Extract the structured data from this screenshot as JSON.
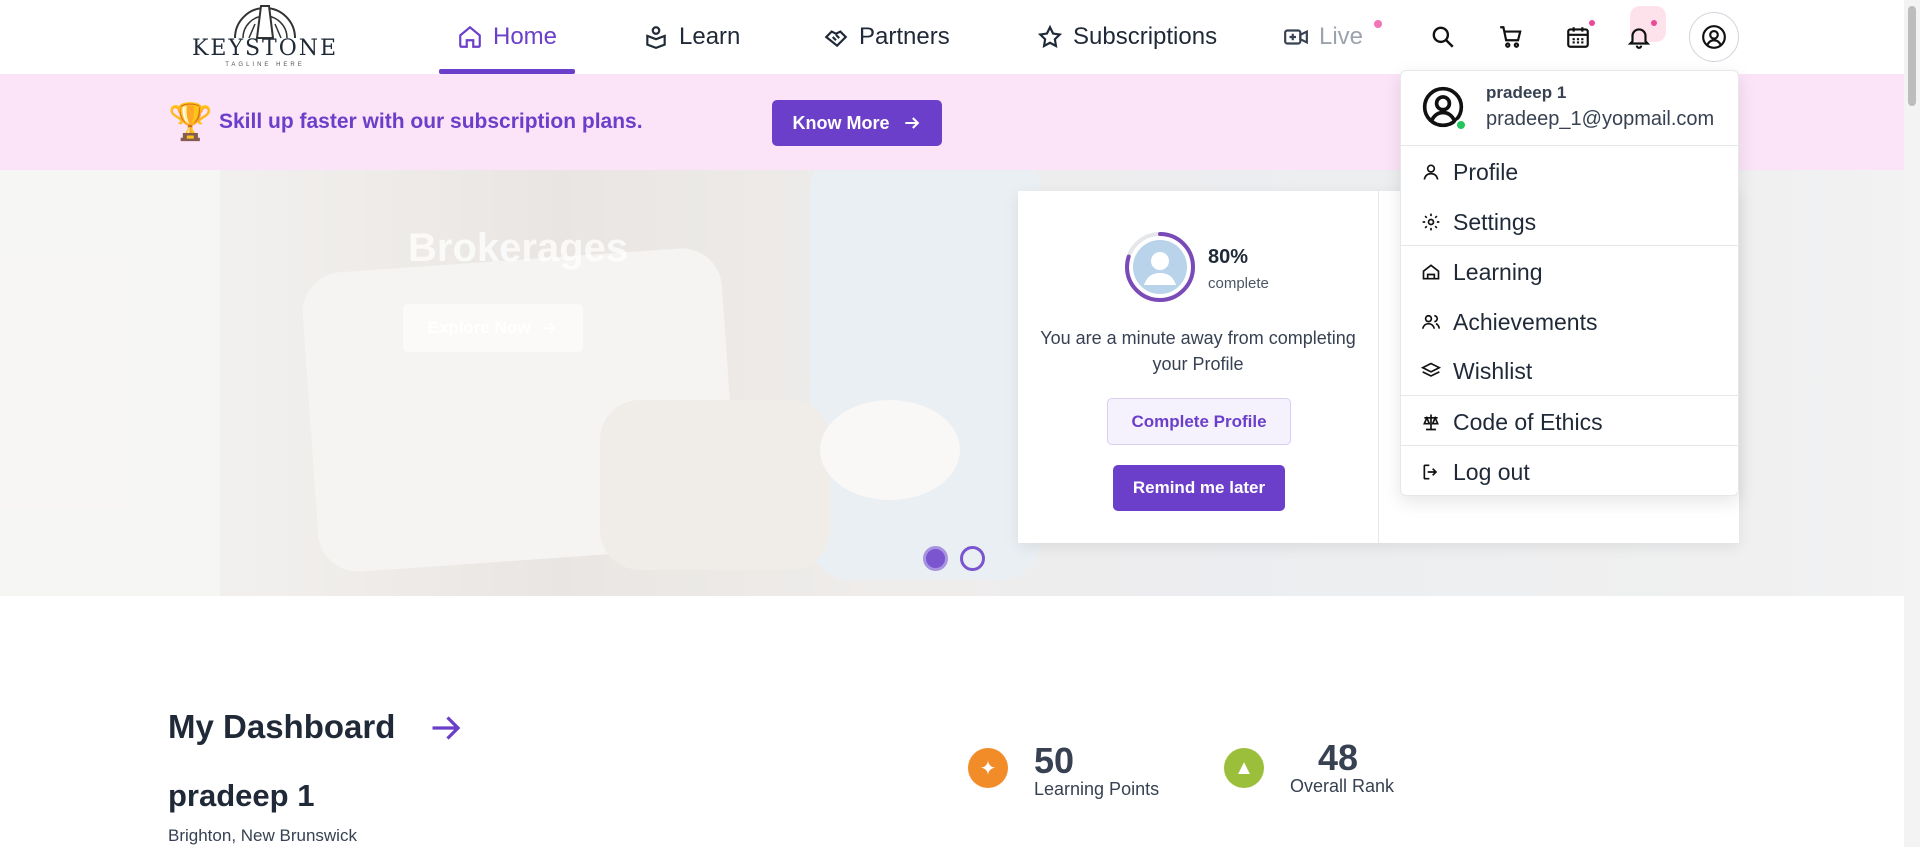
{
  "brand": {
    "name": "KEYSTONE",
    "tagline": "TAGLINE HERE"
  },
  "nav": {
    "home": "Home",
    "learn": "Learn",
    "partners": "Partners",
    "subscriptions": "Subscriptions",
    "live": "Live"
  },
  "promo": {
    "text": "Skill up faster with our subscription plans.",
    "button": "Know More"
  },
  "hero": {
    "title": "Brokerages",
    "button": "Explore Now",
    "slides": 2,
    "active_slide": 1
  },
  "profile_card": {
    "percent": "80%",
    "percent_label": "complete",
    "completion_value": 0.8,
    "message": "You are a minute away from completing your Profile",
    "complete_button": "Complete Profile",
    "remind_button": "Remind me later"
  },
  "user_menu": {
    "name": "pradeep 1",
    "email": "pradeep_1@yopmail.com",
    "items": [
      "Profile",
      "Settings",
      "Learning",
      "Achievements",
      "Wishlist",
      "Code of Ethics",
      "Log out"
    ]
  },
  "dashboard": {
    "title": "My Dashboard",
    "user_name": "pradeep 1",
    "location": "Brighton, New Brunswick",
    "learning_points": "50",
    "learning_points_label": "Learning Points",
    "overall_rank": "48",
    "overall_rank_label": "Overall Rank"
  },
  "colors": {
    "accent": "#6b3fc9",
    "promo_bg": "#fbe4f7",
    "notification_dot": "#f472b6",
    "online": "#22c55e",
    "points_icon": "#f28c28",
    "rank_icon": "#9bbf3a"
  },
  "icons": {
    "home": "home-icon",
    "learn": "learn-icon",
    "partners": "handshake-icon",
    "subscriptions": "star-icon",
    "live": "video-icon",
    "search": "search-icon",
    "cart": "cart-icon",
    "calendar": "calendar-icon",
    "notifications": "bell-icon",
    "account": "user-circle-icon"
  }
}
